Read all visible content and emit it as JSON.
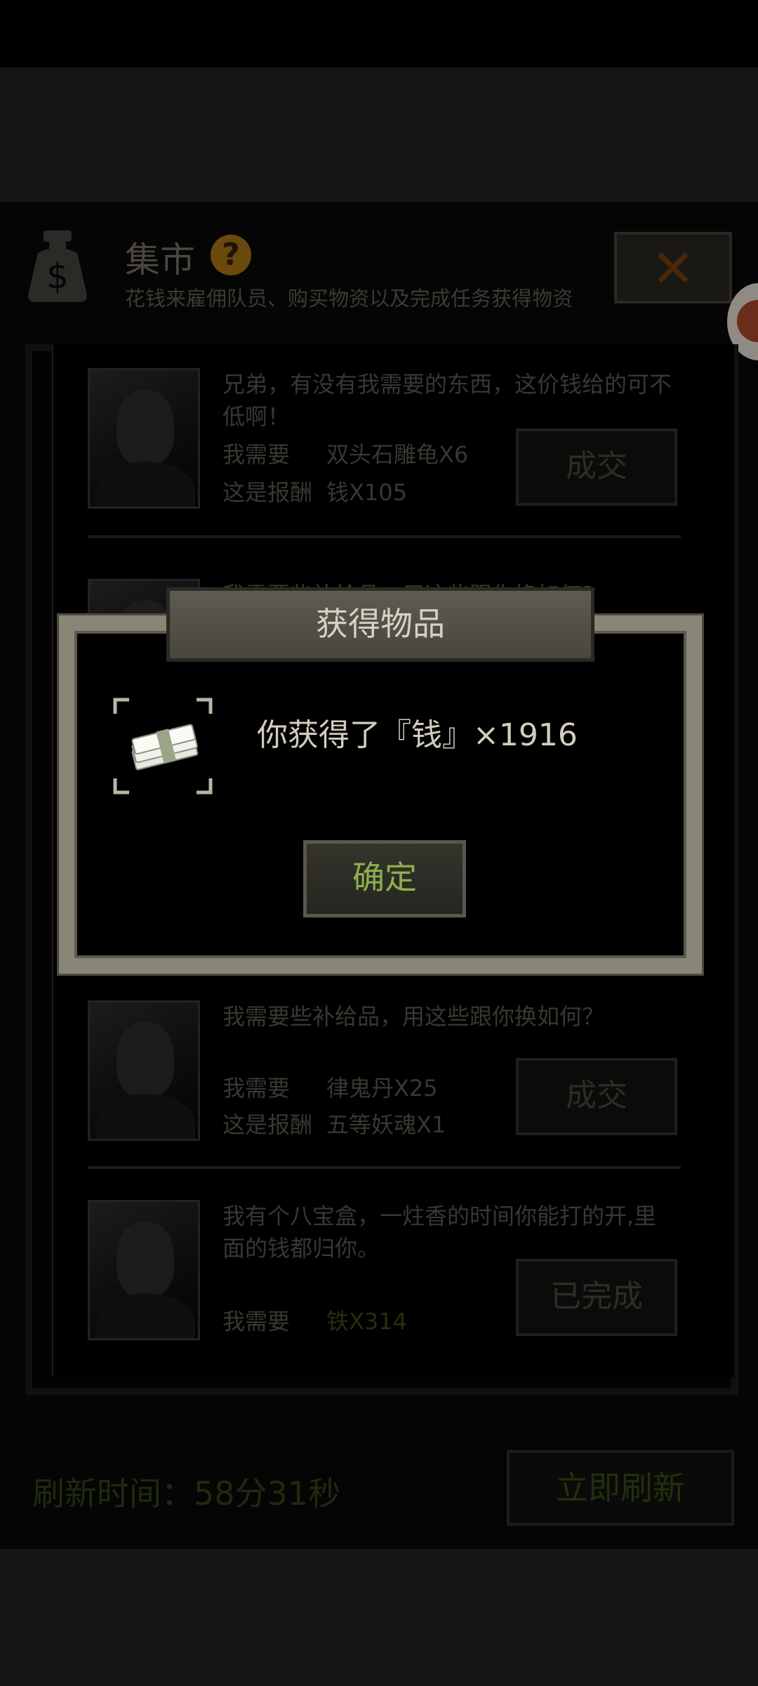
{
  "market": {
    "title": "集市",
    "subtitle": "花钱来雇佣队员、购买物资以及完成任务获得物资",
    "close_label": "✕",
    "help_label": "?"
  },
  "trades": [
    {
      "text": "兄弟，有没有我需要的东西，这价钱给的可不低啊！",
      "need_label": "我需要",
      "need_value": "双头石雕龟X6",
      "reward_label": "这是报酬",
      "reward_value": "钱X105",
      "button": "成交"
    },
    {
      "text": "我需要些补给品，用这些跟你换如何？",
      "need_label": "",
      "need_value": "",
      "reward_label": "",
      "reward_value": "",
      "button": ""
    },
    {
      "text": "我需要些补给品，用这些跟你换如何？",
      "need_label": "我需要",
      "need_value": "律鬼丹X25",
      "reward_label": "这是报酬",
      "reward_value": "五等妖魂X1",
      "button": "成交"
    },
    {
      "text": "我有个八宝盒，一炷香的时间你能打的开,里面的钱都归你。",
      "need_label": "我需要",
      "need_value": "铁X314",
      "reward_label": "",
      "reward_value": "",
      "button": "已完成"
    }
  ],
  "footer": {
    "refresh_time": "刷新时间：58分31秒",
    "refresh_button": "立即刷新"
  },
  "dialog": {
    "title": "获得物品",
    "message": "你获得了『钱』×1916",
    "ok_button": "确定"
  },
  "colors": {
    "accent_green": "#8db04c",
    "frame": "#8a8676",
    "help_gold": "#6a4a0c"
  }
}
